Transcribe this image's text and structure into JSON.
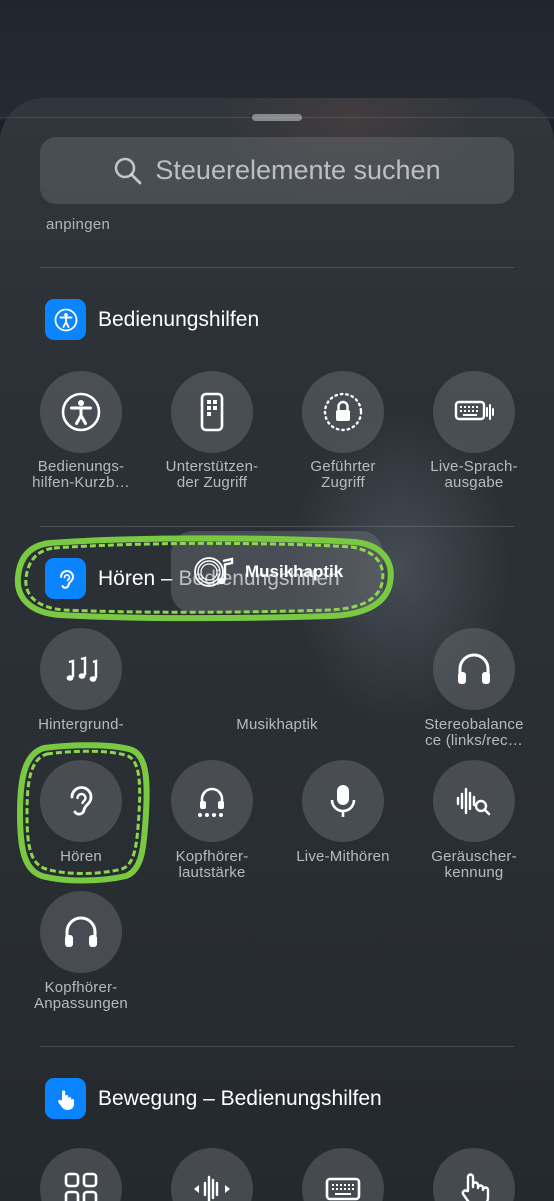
{
  "search": {
    "placeholder": "Steuerelemente suchen"
  },
  "cut_off_label": "anpingen",
  "sections": {
    "accessibility": {
      "title": "Bedienungshilfen",
      "icon": "accessibility-icon",
      "items": [
        {
          "label": "Bedienungs-\nhilfen-Kurzb…",
          "icon": "accessibility-person-icon"
        },
        {
          "label": "Unterstützen-\nder Zugriff",
          "icon": "assistive-access-phone-icon"
        },
        {
          "label": "Geführter\nZugriff",
          "icon": "lock-dotted-circle-icon"
        },
        {
          "label": "Live-Sprach-\nausgabe",
          "icon": "keyboard-speech-icon"
        }
      ]
    },
    "hearing": {
      "title": "Hören – Bedienungshilfen",
      "icon": "ear-icon",
      "items": [
        {
          "label": "Hintergrund-",
          "icon": "music-notes-icon"
        },
        {
          "label": "Musikhaptik",
          "icon": "music-haptics-icon",
          "tile_text": "Musikhaptik"
        },
        {
          "label": "Stereobalance\nce (links/rec…",
          "icon": "headphones-icon"
        },
        {
          "label": "Hören",
          "icon": "ear-icon"
        },
        {
          "label": "Kopfhörer-\nlautstärke",
          "icon": "headphone-level-icon"
        },
        {
          "label": "Live-Mithören",
          "icon": "microphone-icon"
        },
        {
          "label": "Geräuscher-\nkennung",
          "icon": "waveform-search-icon"
        },
        {
          "label": "Kopfhörer-\nAnpassungen",
          "icon": "headphones-icon"
        }
      ]
    },
    "motion": {
      "title": "Bewegung – Bedienungshilfen",
      "icon": "hand-tap-icon",
      "items": [
        {
          "icon": "grid-icon"
        },
        {
          "icon": "audio-arrows-icon"
        },
        {
          "icon": "keyboard-icon"
        },
        {
          "icon": "hand-point-icon"
        }
      ]
    }
  },
  "colors": {
    "accent": "#0a84ff",
    "highlight": "#7ac943"
  }
}
